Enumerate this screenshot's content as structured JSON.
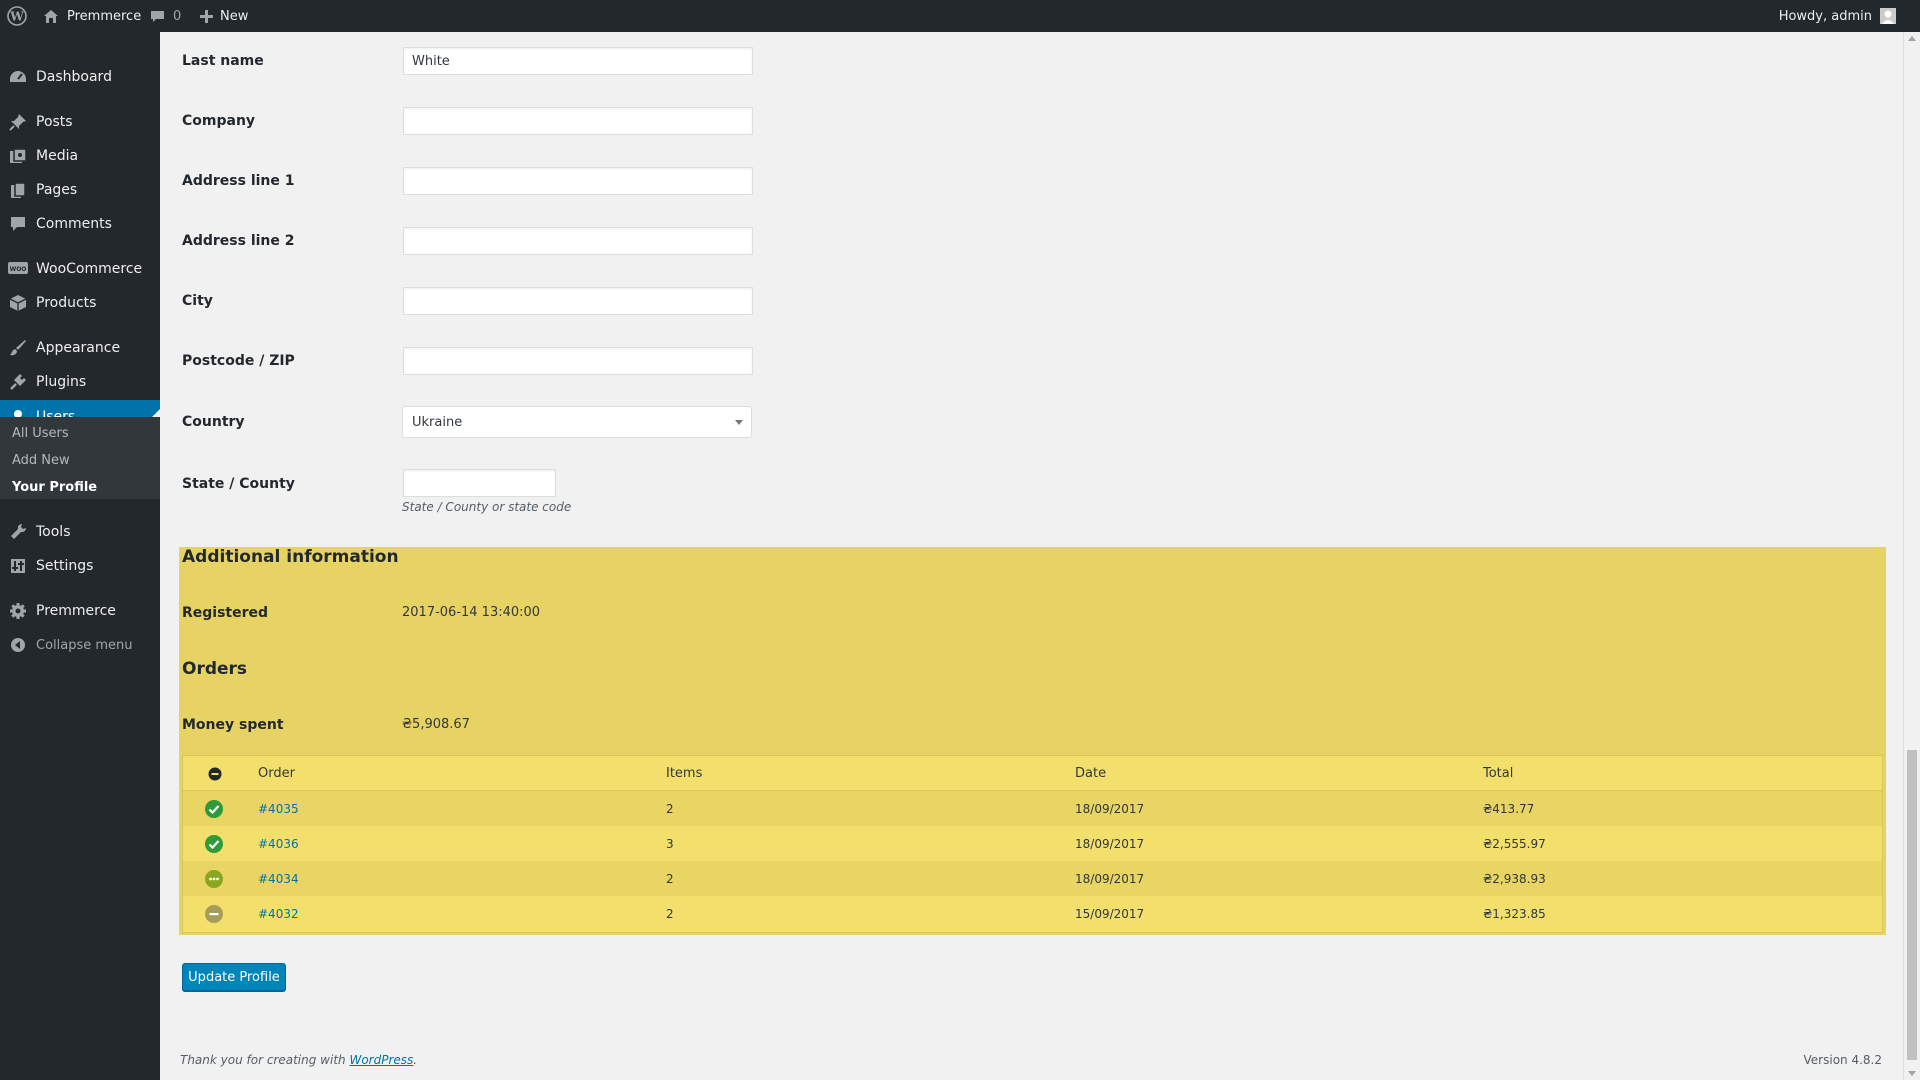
{
  "adminbar": {
    "site_name": "Premmerce",
    "comments_count": "0",
    "new_label": "New",
    "howdy": "Howdy, admin"
  },
  "sidebar": {
    "items": [
      {
        "label": "Dashboard",
        "icon": "dashboard-icon"
      },
      {
        "label": "Posts",
        "icon": "pushpin-icon"
      },
      {
        "label": "Media",
        "icon": "media-icon"
      },
      {
        "label": "Pages",
        "icon": "pages-icon"
      },
      {
        "label": "Comments",
        "icon": "comment-icon"
      },
      {
        "label": "WooCommerce",
        "icon": "woocommerce-icon"
      },
      {
        "label": "Products",
        "icon": "products-box-icon"
      },
      {
        "label": "Appearance",
        "icon": "paintbrush-icon"
      },
      {
        "label": "Plugins",
        "icon": "plugin-icon"
      },
      {
        "label": "Users",
        "icon": "user-icon"
      },
      {
        "label": "Tools",
        "icon": "wrench-icon"
      },
      {
        "label": "Settings",
        "icon": "settings-icon"
      },
      {
        "label": "Premmerce",
        "icon": "gear-icon"
      }
    ],
    "submenu": [
      "All Users",
      "Add New",
      "Your Profile"
    ],
    "collapse_label": "Collapse menu"
  },
  "form": {
    "fields": [
      {
        "label": "Last name",
        "value": "White"
      },
      {
        "label": "Company",
        "value": ""
      },
      {
        "label": "Address line 1",
        "value": ""
      },
      {
        "label": "Address line 2",
        "value": ""
      },
      {
        "label": "City",
        "value": ""
      },
      {
        "label": "Postcode / ZIP",
        "value": ""
      }
    ],
    "country_label": "Country",
    "country_value": "Ukraine",
    "state_label": "State / County",
    "state_value": "",
    "state_hint": "State / County or state code"
  },
  "additional": {
    "heading": "Additional information",
    "registered_label": "Registered",
    "registered_value": "2017-06-14 13:40:00",
    "orders_heading": "Orders",
    "money_label": "Money spent",
    "money_value": "₴5,908.67"
  },
  "orders": {
    "columns": [
      "Order",
      "Items",
      "Date",
      "Total"
    ],
    "rows": [
      {
        "status": "completed",
        "order": "#4035",
        "items": "2",
        "date": "18/09/2017",
        "total": "₴413.77"
      },
      {
        "status": "completed",
        "order": "#4036",
        "items": "3",
        "date": "18/09/2017",
        "total": "₴2,555.97"
      },
      {
        "status": "processing",
        "order": "#4034",
        "items": "2",
        "date": "18/09/2017",
        "total": "₴2,938.93"
      },
      {
        "status": "on-hold",
        "order": "#4032",
        "items": "2",
        "date": "15/09/2017",
        "total": "₴1,323.85"
      }
    ]
  },
  "update_button": "Update Profile",
  "footer": {
    "thanks_prefix": "Thank you for creating with ",
    "thanks_link": "WordPress",
    "thanks_suffix": ".",
    "version": "Version 4.8.2"
  },
  "colors": {
    "adminbar": "#23282d",
    "accent": "#0073aa",
    "highlight": "#e6d364",
    "completed": "#2e9a3a",
    "processing": "#8aa520",
    "on_hold": "#a59c5a"
  }
}
